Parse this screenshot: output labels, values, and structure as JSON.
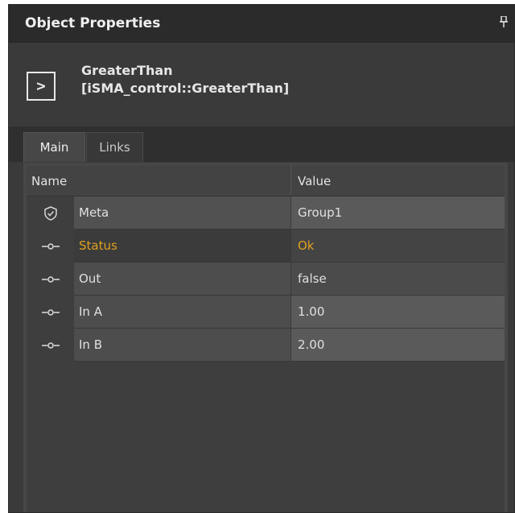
{
  "panel": {
    "title": "Object Properties",
    "pin_icon": "pin-icon"
  },
  "object": {
    "icon": "greater-than-icon",
    "icon_glyph": ">",
    "name": "GreaterThan",
    "type": "[iSMA_control::GreaterThan]"
  },
  "tabs": [
    {
      "label": "Main",
      "active": true
    },
    {
      "label": "Links",
      "active": false
    }
  ],
  "grid": {
    "headers": {
      "name": "Name",
      "value": "Value"
    },
    "rows": [
      {
        "icon": "shield-icon",
        "name": "Meta",
        "value": "Group1"
      },
      {
        "icon": "slot-icon",
        "name": "Status",
        "value": "Ok",
        "color": "#e0a020"
      },
      {
        "icon": "slot-icon",
        "name": "Out",
        "value": "false"
      },
      {
        "icon": "slot-icon",
        "name": "In A",
        "value": "1.00"
      },
      {
        "icon": "slot-icon",
        "name": "In B",
        "value": "2.00"
      }
    ]
  }
}
